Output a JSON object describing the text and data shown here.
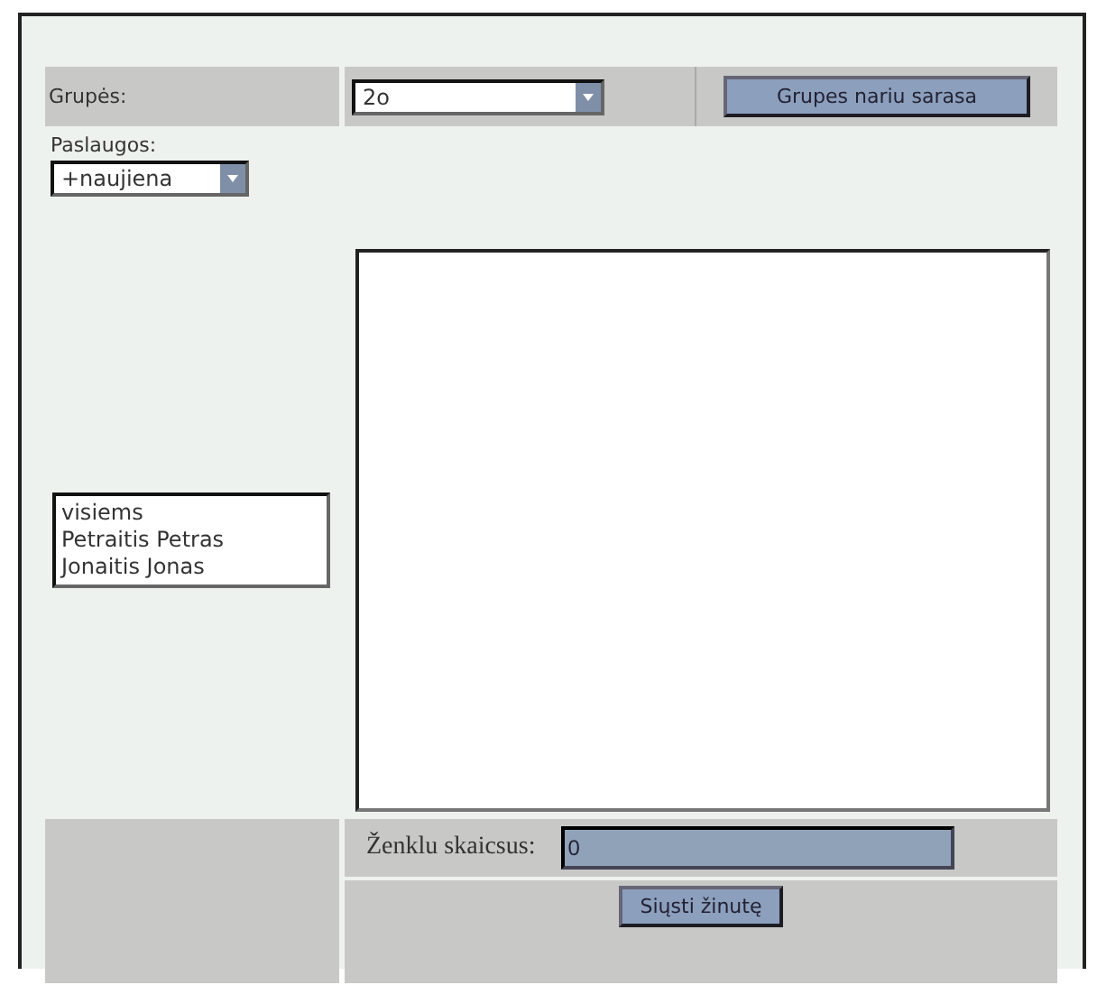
{
  "groups": {
    "label": "Grupės:",
    "value": "2o",
    "button": "Grupes nariu sarasa"
  },
  "services": {
    "label": "Paslaugos:",
    "value": "+naujiena"
  },
  "recipients": [
    "visiems",
    "Petraitis Petras",
    "Jonaitis Jonas"
  ],
  "counter": {
    "label": "Ženklu skaicsus:",
    "value": "0"
  },
  "send_button": "Siųsti žinutę"
}
